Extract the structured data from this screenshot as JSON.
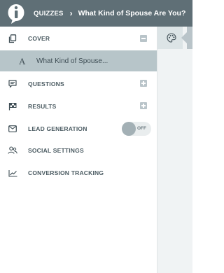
{
  "header": {
    "breadcrumb_root": "QUIZZES",
    "breadcrumb_separator": "›",
    "breadcrumb_current": "What Kind of Spouse Are You?",
    "logo_icon": "info-logo-icon"
  },
  "sidebar": {
    "cover": {
      "label": "COVER",
      "icon": "copy-icon",
      "control": "collapse-minus"
    },
    "cover_sub": {
      "glyph": "A",
      "label": "What Kind of Spouse..."
    },
    "questions": {
      "label": "QUESTIONS",
      "icon": "chat-icon",
      "control": "expand-plus"
    },
    "results": {
      "label": "RESULTS",
      "icon": "flag-icon",
      "control": "expand-plus"
    },
    "lead_generation": {
      "label": "LEAD GENERATION",
      "icon": "mail-icon",
      "toggle_state": "OFF"
    },
    "social_settings": {
      "label": "SOCIAL SETTINGS",
      "icon": "users-icon"
    },
    "conversion_tracking": {
      "label": "CONVERSION TRACKING",
      "icon": "chart-icon"
    }
  },
  "rail": {
    "tab_icon": "palette-icon"
  },
  "colors": {
    "topbar": "#5f6f76",
    "selected": "#b7c5c9",
    "text": "#4a5a61",
    "control": "#b9c4c9"
  }
}
